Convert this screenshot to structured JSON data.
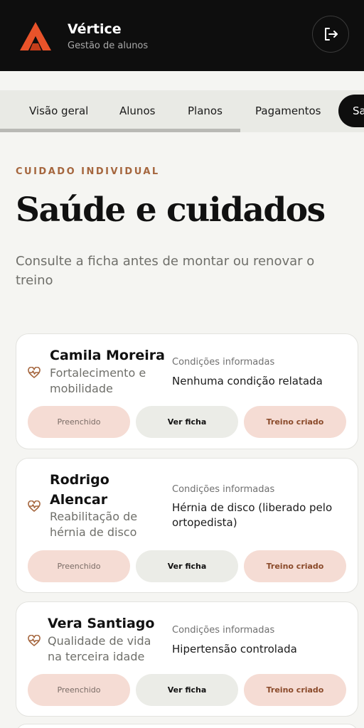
{
  "app": {
    "name": "Vértice",
    "subtitle": "Gestão de alunos",
    "logout_icon": "logout-icon"
  },
  "tabs": [
    {
      "label": "Visão geral"
    },
    {
      "label": "Alunos"
    },
    {
      "label": "Planos"
    },
    {
      "label": "Pagamentos"
    },
    {
      "label": "Sa"
    }
  ],
  "page": {
    "eyebrow": "CUIDADO INDIVIDUAL",
    "title": "Saúde e cuidados",
    "subtitle": "Consulte a ficha antes de montar ou renovar o treino"
  },
  "students": [
    {
      "name": "Camila Moreira",
      "goal": "Fortalecimento e mobilidade",
      "conditions_label": "Condições informadas",
      "conditions": "Nenhuma condição relatada",
      "status": "Preenchido",
      "view": "Ver ficha",
      "plan": "Treino criado"
    },
    {
      "name": "Rodrigo Alencar",
      "goal": "Reabilitação de hérnia de disco",
      "conditions_label": "Condições informadas",
      "conditions": "Hérnia de disco (liberado pelo ortopedista)",
      "status": "Preenchido",
      "view": "Ver ficha",
      "plan": "Treino criado"
    },
    {
      "name": "Vera Santiago",
      "goal": "Qualidade de vida na terceira idade",
      "conditions_label": "Condições informadas",
      "conditions": "Hipertensão controlada",
      "status": "Preenchido",
      "view": "Ver ficha",
      "plan": "Treino criado"
    }
  ],
  "colors": {
    "accent": "#e8532a",
    "eyebrow": "#a5663e",
    "pill_pink": "#f5dcd4",
    "pill_gray": "#ebece7",
    "header": "#0e0e0e"
  }
}
